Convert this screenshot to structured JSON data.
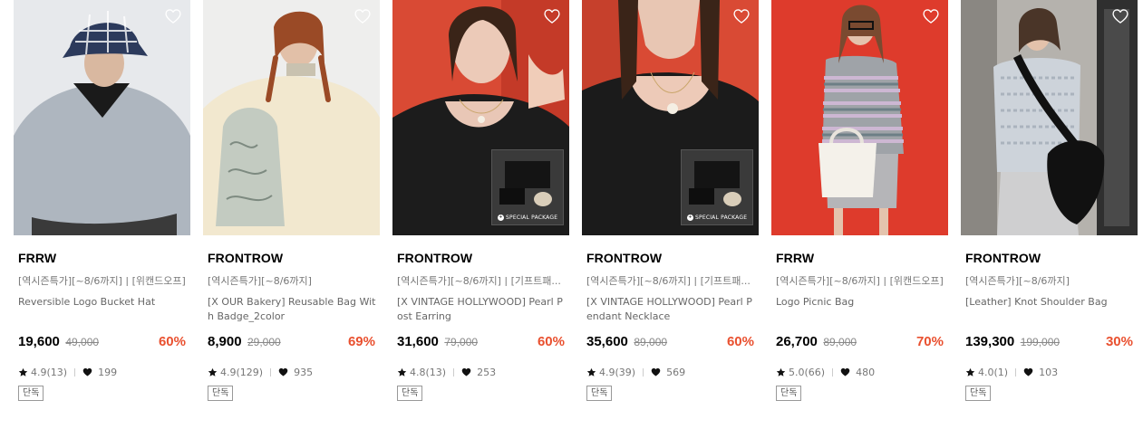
{
  "products": [
    {
      "brand": "FRRW",
      "promo": "[역시즌특가][~8/6까지] | [위캔드오프]",
      "name": "Reversible Logo Bucket Hat",
      "price": "19,600",
      "original_price": "49,000",
      "discount": "60%",
      "rating": "4.9(13)",
      "likes": "199",
      "badge": "단독"
    },
    {
      "brand": "FRONTROW",
      "promo": "[역시즌특가][~8/6까지]",
      "name": "[X OUR Bakery] Reusable Bag With Badge_2color",
      "price": "8,900",
      "original_price": "29,000",
      "discount": "69%",
      "rating": "4.9(129)",
      "likes": "935",
      "badge": "단독"
    },
    {
      "brand": "FRONTROW",
      "promo": "[역시즌특가][~8/6까지] | [기프트패...",
      "name": "[X VINTAGE HOLLYWOOD] Pearl P ost Earring",
      "price": "31,600",
      "original_price": "79,000",
      "discount": "60%",
      "rating": "4.8(13)",
      "likes": "253",
      "badge": "단독",
      "package_label": "SPECIAL PACKAGE"
    },
    {
      "brand": "FRONTROW",
      "promo": "[역시즌특가][~8/6까지] | [기프트패...",
      "name": "[X VINTAGE HOLLYWOOD] Pearl P endant Necklace",
      "price": "35,600",
      "original_price": "89,000",
      "discount": "60%",
      "rating": "4.9(39)",
      "likes": "569",
      "badge": "단독",
      "package_label": "SPECIAL PACKAGE"
    },
    {
      "brand": "FRRW",
      "promo": "[역시즌특가][~8/6까지] | [위캔드오프]",
      "name": "Logo Picnic Bag",
      "price": "26,700",
      "original_price": "89,000",
      "discount": "70%",
      "rating": "5.0(66)",
      "likes": "480",
      "badge": "단독"
    },
    {
      "brand": "FRONTROW",
      "promo": "[역시즌특가][~8/6까지]",
      "name": "[Leather] Knot Shoulder Bag",
      "price": "139,300",
      "original_price": "199,000",
      "discount": "30%",
      "rating": "4.0(1)",
      "likes": "103",
      "badge": "단독"
    }
  ],
  "colors": {
    "discount": "#e9502f",
    "brand_text": "#000000",
    "muted_text": "#777777"
  },
  "icons": {
    "wishlist": "heart-outline-icon",
    "rating": "star-icon",
    "likes": "heart-filled-icon"
  }
}
